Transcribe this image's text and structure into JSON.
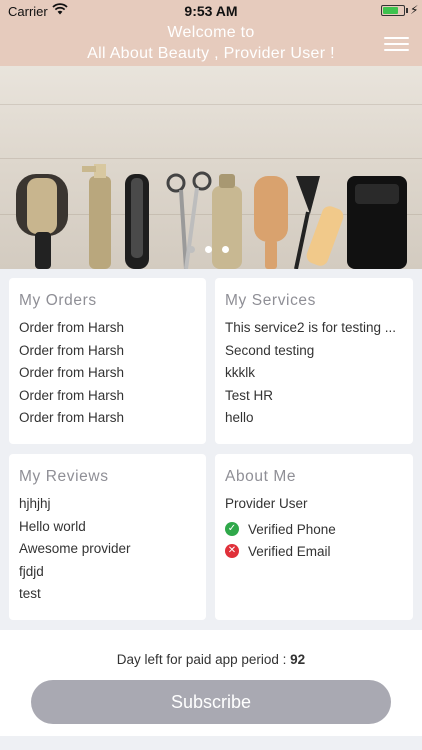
{
  "status_bar": {
    "carrier": "Carrier",
    "time": "9:53 AM",
    "battery_level": 0.75,
    "wifi_icon": "wifi-icon",
    "charging_icon": "lightning-bolt-icon"
  },
  "header": {
    "welcome_line1": "Welcome to",
    "welcome_line2": "All About Beauty , Provider User !",
    "menu_icon": "hamburger-menu-icon",
    "background_color": "#e6cbbd"
  },
  "carousel": {
    "slide_count": 3,
    "active_slide": 1
  },
  "orders": {
    "title": "My Orders",
    "items": [
      "Order from Harsh",
      "Order from Harsh",
      "Order from Harsh",
      "Order from Harsh",
      "Order from Harsh"
    ]
  },
  "services": {
    "title": "My Services",
    "items": [
      "This service2 is for testing ...",
      "Second testing",
      "kkklk",
      "Test HR",
      "hello"
    ]
  },
  "reviews": {
    "title": "My Reviews",
    "items": [
      "hjhjhj",
      "Hello world",
      "Awesome provider",
      "fjdjd",
      "test"
    ]
  },
  "about": {
    "title": "About Me",
    "name": "Provider User",
    "verified_phone": "Verified Phone",
    "verified_email": "Verified Email",
    "phone_status_icon": "check-circle-icon",
    "email_status_icon": "x-circle-icon",
    "phone_status_color": "#2fa84a",
    "email_status_color": "#e0303a"
  },
  "footer": {
    "days_label": "Day left for paid app period : ",
    "days_value": "92",
    "subscribe_label": "Subscribe",
    "button_color": "#a9a9b2"
  }
}
